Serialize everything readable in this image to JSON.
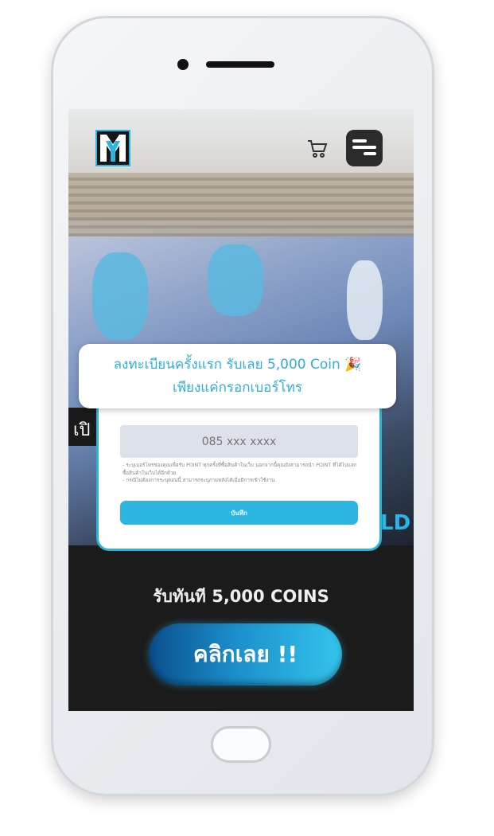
{
  "header": {
    "logo_text": "MY",
    "cart_icon": "cart-icon",
    "menu_icon": "menu-icon"
  },
  "banner": {
    "line1": "ลงทะเบียนครั้งแรก รับเลย 5,000 Coin 🎉",
    "line2": "เพียงแค่กรอกเบอร์โทร"
  },
  "background": {
    "partial_text_left": "เปิ",
    "partial_text_right": "LD"
  },
  "form": {
    "phone_placeholder": "085 xxx xxxx",
    "notes": [
      "ระบุเบอร์โทรของคุณเพื่อรับ POINT ทุกครั้งที่ซื้อสินค้าในเว็บ นอกจากนี้คุณยังสามารถนำ POINT ที่ได้ไปแลกซื้อสินค้าในเว็บได้อีกด้วย",
      "กรณีไม่ต้องการระบุตอนนี้ สามารถระบุภายหลังได้เมื่อมีการเข้าใช้งาน"
    ],
    "save_label": "บันทึก"
  },
  "promo": {
    "headline": "รับทันที 5,000 COINS",
    "cta_label": "คลิกเลย !!"
  },
  "colors": {
    "accent": "#2bb5e0",
    "dark": "#1b1b1b"
  }
}
